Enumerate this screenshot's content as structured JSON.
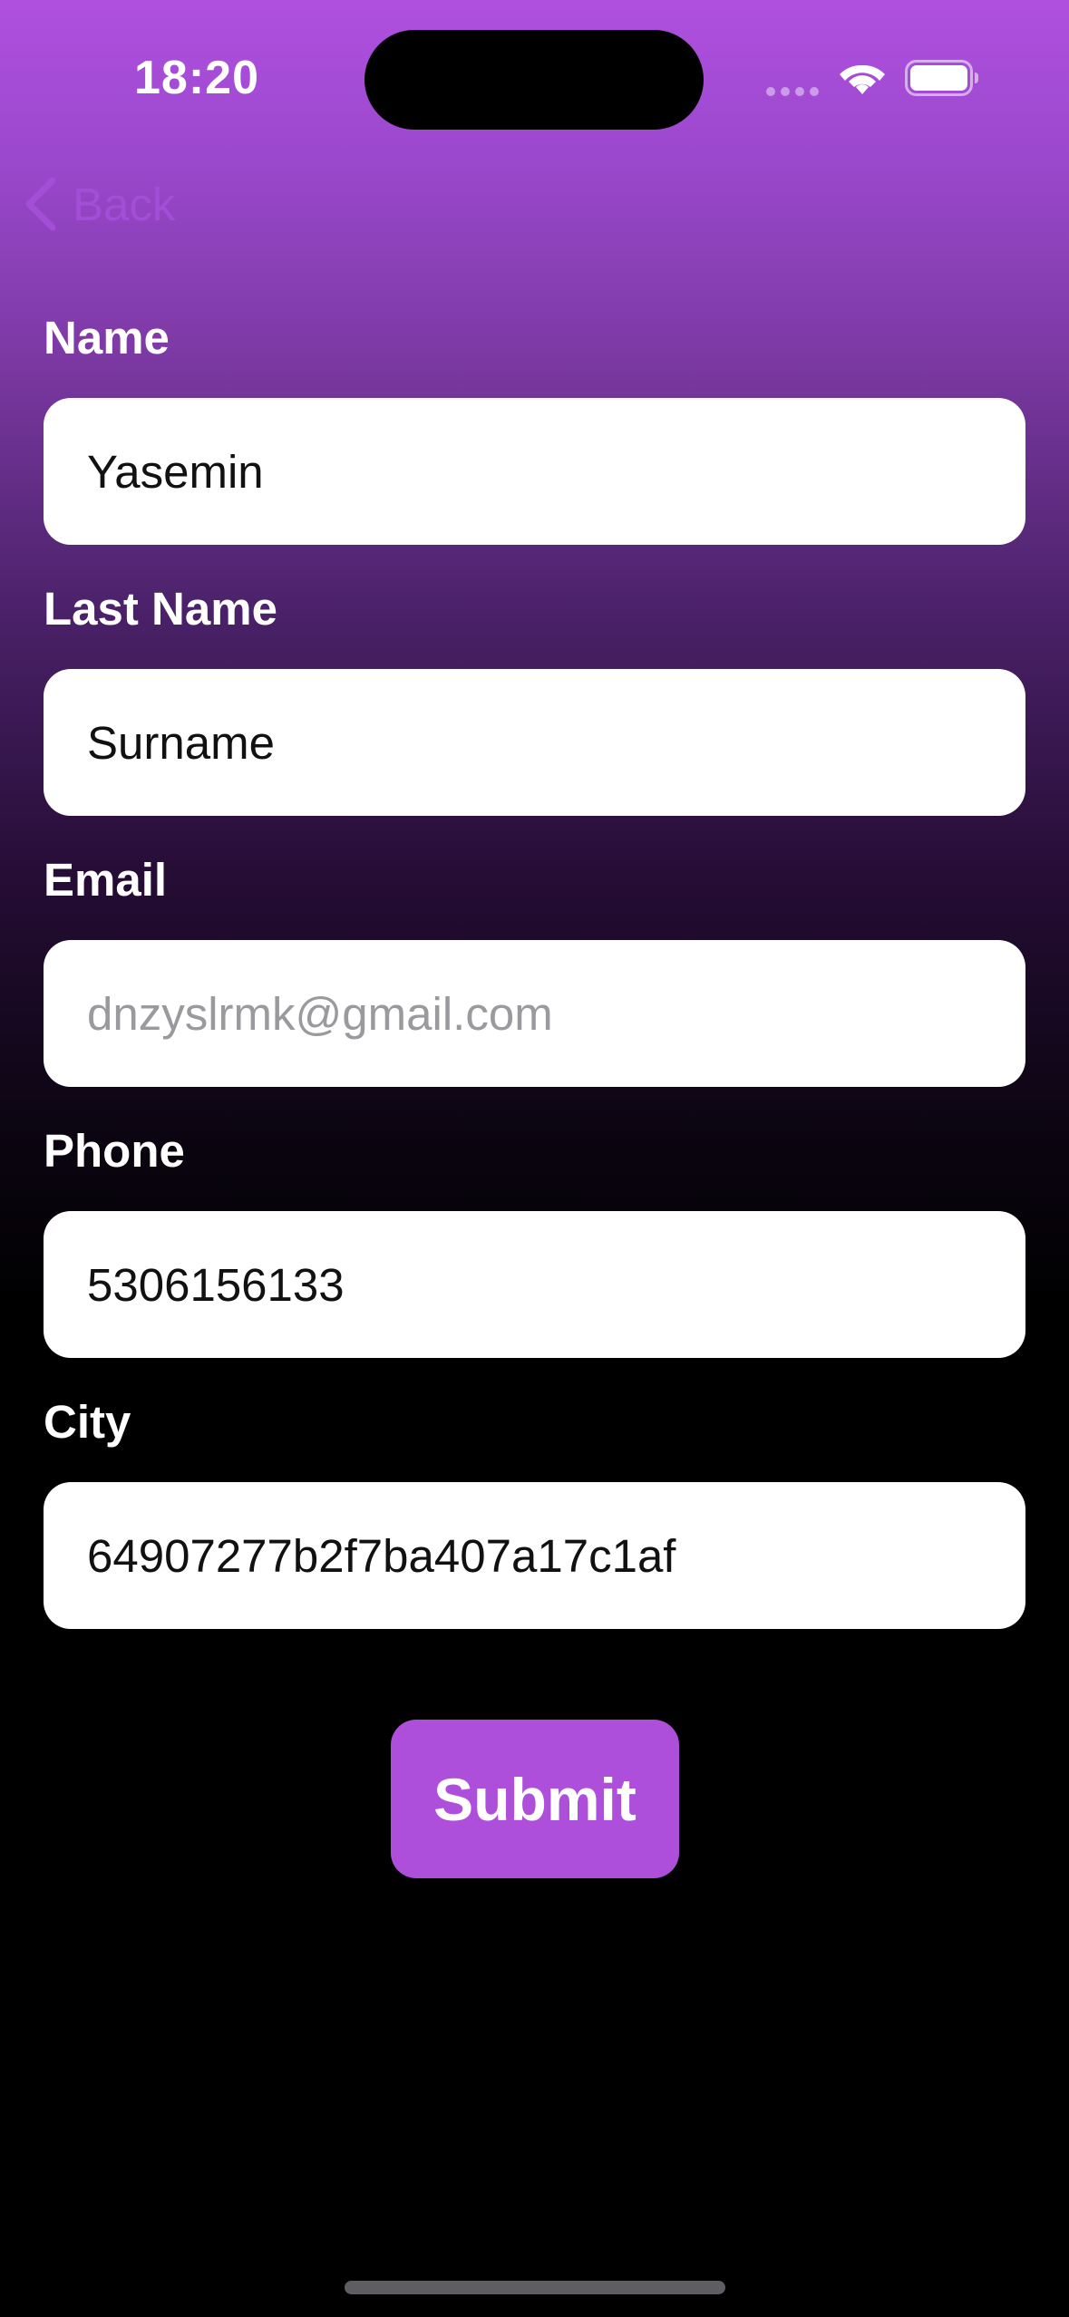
{
  "status_bar": {
    "time": "18:20"
  },
  "nav": {
    "back_label": "Back"
  },
  "form": {
    "fields": [
      {
        "label": "Name",
        "value": "Yasemin",
        "placeholder": ""
      },
      {
        "label": "Last Name",
        "value": "Surname",
        "placeholder": ""
      },
      {
        "label": "Email",
        "value": "",
        "placeholder": "dnzyslrmk@gmail.com"
      },
      {
        "label": "Phone",
        "value": "5306156133",
        "placeholder": ""
      },
      {
        "label": "City",
        "value": "64907277b2f7ba407a17c1af",
        "placeholder": ""
      }
    ],
    "submit_label": "Submit"
  },
  "colors": {
    "accent": "#ad4fdb",
    "back_tint": "#a24ed6",
    "gradient_top": "#b050e0",
    "gradient_bottom": "#000000"
  },
  "icons": {
    "back": "chevron-left-icon",
    "wifi": "wifi-icon",
    "battery": "battery-icon",
    "signal": "signal-dots-icon"
  }
}
